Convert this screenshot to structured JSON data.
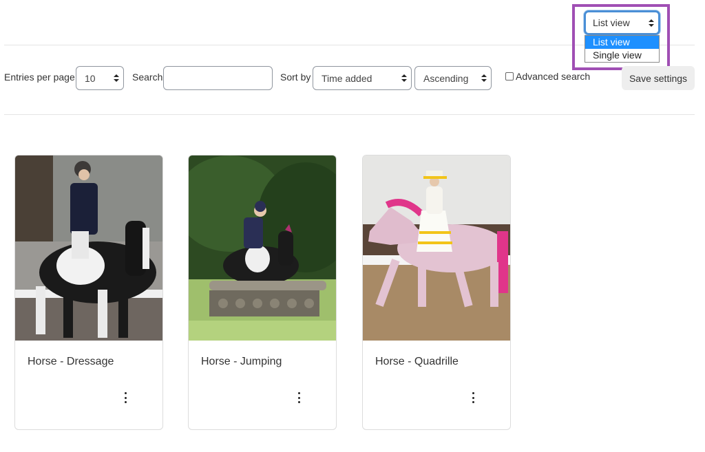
{
  "view_selector": {
    "current": "List view",
    "options": [
      {
        "label": "List view",
        "selected": true
      },
      {
        "label": "Single view",
        "selected": false
      }
    ],
    "highlight_color": "#a04fb4",
    "focus_color": "#4a8fd6",
    "selected_option_color": "#1e90ff"
  },
  "filters": {
    "entries_label": "Entries per page",
    "entries_value": "10",
    "search_label": "Search",
    "search_value": "",
    "sort_label": "Sort by",
    "sort_value": "Time added",
    "order_value": "Ascending",
    "advanced_search_label": "Advanced search",
    "advanced_search_checked": false,
    "save_label": "Save settings"
  },
  "entries": [
    {
      "title": "Horse - Dressage",
      "image": "horse-dressage-photo",
      "menu_icon": "kebab-menu-icon"
    },
    {
      "title": "Horse - Jumping",
      "image": "horse-jumping-photo",
      "menu_icon": "kebab-menu-icon"
    },
    {
      "title": "Horse - Quadrille",
      "image": "horse-quadrille-photo",
      "menu_icon": "kebab-menu-icon"
    }
  ]
}
